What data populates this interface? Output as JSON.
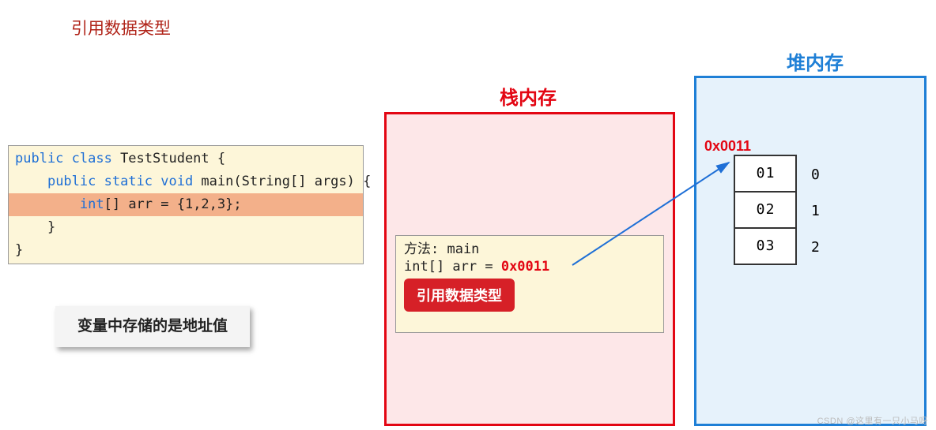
{
  "title_ref": "引用数据类型",
  "code": {
    "l1": {
      "kw": "public class",
      "rest": " TestStudent {"
    },
    "l2": {
      "indent": "    ",
      "kw": "public static void",
      "rest": " main(String[] args) {"
    },
    "l3": {
      "indent": "        ",
      "kw": "int",
      "rest": "[] arr = {1,2,3};"
    },
    "l4": "    }",
    "l5": "}"
  },
  "note": "变量中存储的是地址值",
  "stack": {
    "title": "栈内存",
    "frame_title": "方法: main",
    "var_decl": "int[] arr = ",
    "address": "0x0011",
    "badge": "引用数据类型"
  },
  "heap": {
    "title": "堆内存",
    "address": "0x0011",
    "cells": [
      {
        "a": "0",
        "b": "1",
        "idx": "0"
      },
      {
        "a": "0",
        "b": "2",
        "idx": "1"
      },
      {
        "a": "0",
        "b": "3",
        "idx": "2"
      }
    ]
  },
  "watermark": "CSDN @这里有一只小马呀"
}
